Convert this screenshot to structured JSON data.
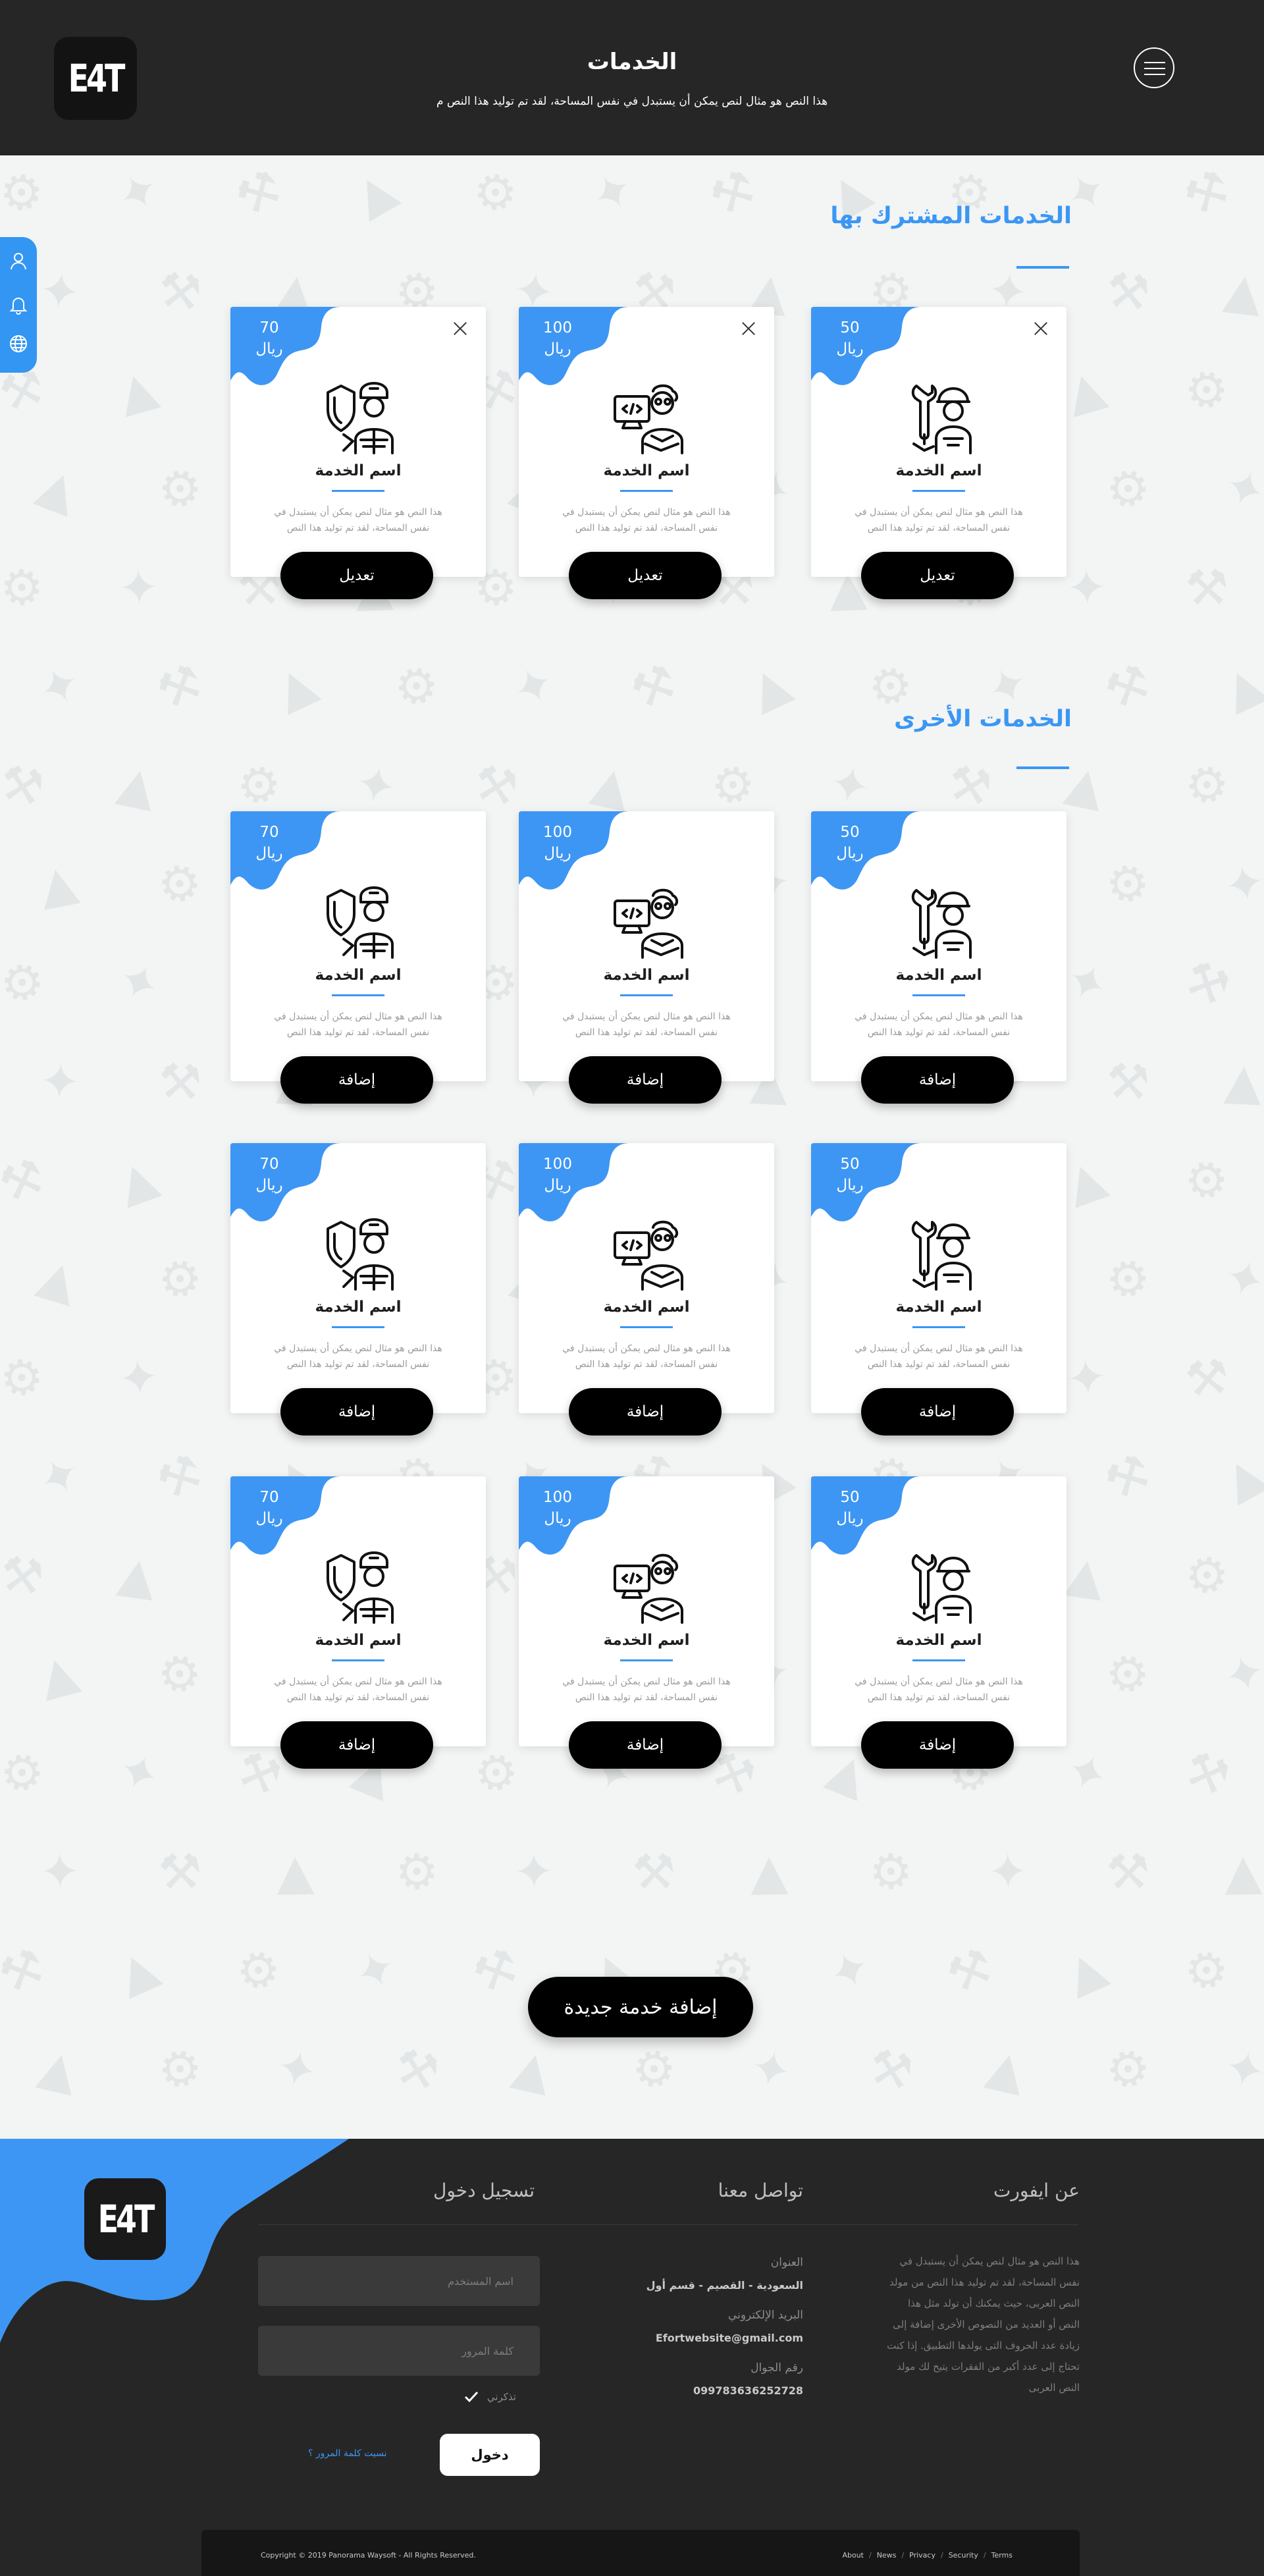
{
  "header": {
    "logo_text": "E4T",
    "title": "الخدمات",
    "subtitle": "هذا النص هو مثال لنص يمكن أن يستبدل في نفس المساحة، لقد تم توليد هذا النص م"
  },
  "colors": {
    "accent": "#3a97f4",
    "dark": "#262626",
    "button": "#000000"
  },
  "subscribed": {
    "title": "الخدمات المشترك بها",
    "cards": [
      {
        "price": "50",
        "currency": "ريال",
        "icon": "mechanic-icon",
        "name": "اسم الخدمة",
        "desc": "هذا النص هو مثال لنص يمكن أن يستبدل في نفس المساحة، لقد تم توليد هذا النص",
        "button": "تعديل"
      },
      {
        "price": "100",
        "currency": "ريال",
        "icon": "programmer-icon",
        "name": "اسم الخدمة",
        "desc": "هذا النص هو مثال لنص يمكن أن يستبدل في نفس المساحة، لقد تم توليد هذا النص",
        "button": "تعديل"
      },
      {
        "price": "70",
        "currency": "ريال",
        "icon": "security-guard-icon",
        "name": "اسم الخدمة",
        "desc": "هذا النص هو مثال لنص يمكن أن يستبدل في نفس المساحة، لقد تم توليد هذا النص",
        "button": "تعديل"
      }
    ]
  },
  "others": {
    "title": "الخدمات الأخرى",
    "cards": [
      {
        "price": "50",
        "currency": "ريال",
        "icon": "mechanic-icon",
        "name": "اسم الخدمة",
        "desc": "هذا النص هو مثال لنص يمكن أن يستبدل في نفس المساحة، لقد تم توليد هذا النص",
        "button": "إضافة"
      },
      {
        "price": "100",
        "currency": "ريال",
        "icon": "programmer-icon",
        "name": "اسم الخدمة",
        "desc": "هذا النص هو مثال لنص يمكن أن يستبدل في نفس المساحة، لقد تم توليد هذا النص",
        "button": "إضافة"
      },
      {
        "price": "70",
        "currency": "ريال",
        "icon": "security-guard-icon",
        "name": "اسم الخدمة",
        "desc": "هذا النص هو مثال لنص يمكن أن يستبدل في نفس المساحة، لقد تم توليد هذا النص",
        "button": "إضافة"
      },
      {
        "price": "50",
        "currency": "ريال",
        "icon": "mechanic-icon",
        "name": "اسم الخدمة",
        "desc": "هذا النص هو مثال لنص يمكن أن يستبدل في نفس المساحة، لقد تم توليد هذا النص",
        "button": "إضافة"
      },
      {
        "price": "100",
        "currency": "ريال",
        "icon": "programmer-icon",
        "name": "اسم الخدمة",
        "desc": "هذا النص هو مثال لنص يمكن أن يستبدل في نفس المساحة، لقد تم توليد هذا النص",
        "button": "إضافة"
      },
      {
        "price": "70",
        "currency": "ريال",
        "icon": "security-guard-icon",
        "name": "اسم الخدمة",
        "desc": "هذا النص هو مثال لنص يمكن أن يستبدل في نفس المساحة، لقد تم توليد هذا النص",
        "button": "إضافة"
      },
      {
        "price": "50",
        "currency": "ريال",
        "icon": "mechanic-icon",
        "name": "اسم الخدمة",
        "desc": "هذا النص هو مثال لنص يمكن أن يستبدل في نفس المساحة، لقد تم توليد هذا النص",
        "button": "إضافة"
      },
      {
        "price": "100",
        "currency": "ريال",
        "icon": "programmer-icon",
        "name": "اسم الخدمة",
        "desc": "هذا النص هو مثال لنص يمكن أن يستبدل في نفس المساحة، لقد تم توليد هذا النص",
        "button": "إضافة"
      },
      {
        "price": "70",
        "currency": "ريال",
        "icon": "security-guard-icon",
        "name": "اسم الخدمة",
        "desc": "هذا النص هو مثال لنص يمكن أن يستبدل في نفس المساحة، لقد تم توليد هذا النص",
        "button": "إضافة"
      }
    ]
  },
  "add_new_button": "إضافة خدمة جديدة",
  "side_tab": {
    "icons": [
      "user-icon",
      "bell-icon",
      "globe-icon"
    ]
  },
  "footer": {
    "logo_text": "E4T",
    "about": {
      "title": "عن ايفورت",
      "text": "هذا النص هو مثال لنص يمكن أن يستبدل في نفس المساحة، لقد تم توليد هذا النص من مولد النص العربى، حيث يمكنك أن تولد مثل هذا النص أو العديد من النصوص الأخرى إضافة إلى زيادة عدد الحروف التى يولدها التطبيق. إذا كنت تحتاج إلى عدد أكبر من الفقرات يتيح لك مولد النص العربى"
    },
    "contact": {
      "title": "تواصل معنا",
      "address_label": "العنوان",
      "address": "السعودية - القصيم - قسم أول",
      "email_label": "البريد الإلكتروني",
      "email": "Efortwebsite@gmail.com",
      "phone_label": "رقم الجوال",
      "phone": "099783636252728"
    },
    "login": {
      "title": "تسجيل دخول",
      "username_placeholder": "اسم المستخدم",
      "password_placeholder": "كلمة المرور",
      "remember": "تذكرني",
      "button": "دخول",
      "forgot": "نسيت كلمة المرور ؟"
    },
    "copyright": "Copyright © 2019  Panorama Waysoft  -  All Rights Reserved.",
    "links": [
      "About",
      "News",
      "Privacy",
      "Security",
      "Terms"
    ]
  }
}
